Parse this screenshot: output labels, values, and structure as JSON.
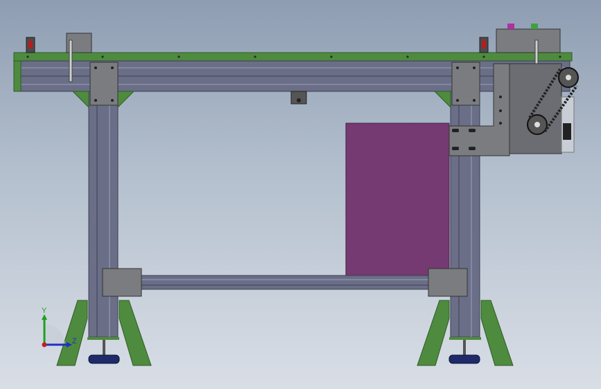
{
  "viewport": {
    "name": "conveyor-frame-front-view"
  },
  "triad": {
    "y_label": "Y",
    "z_label": "Z"
  },
  "colors": {
    "frame_green": "#4e8b3f",
    "frame_dark_green": "#2f5a26",
    "profile_grey": "#6a6e86",
    "profile_dark": "#3c3f52",
    "plate_grey": "#7a7c80",
    "plate_dark": "#4a4b4f",
    "panel_purple": "#753a72",
    "foot_navy": "#1e2a6a",
    "axis_y": "#1ea01e",
    "axis_z": "#2030c0",
    "axis_x": "#c02020"
  }
}
